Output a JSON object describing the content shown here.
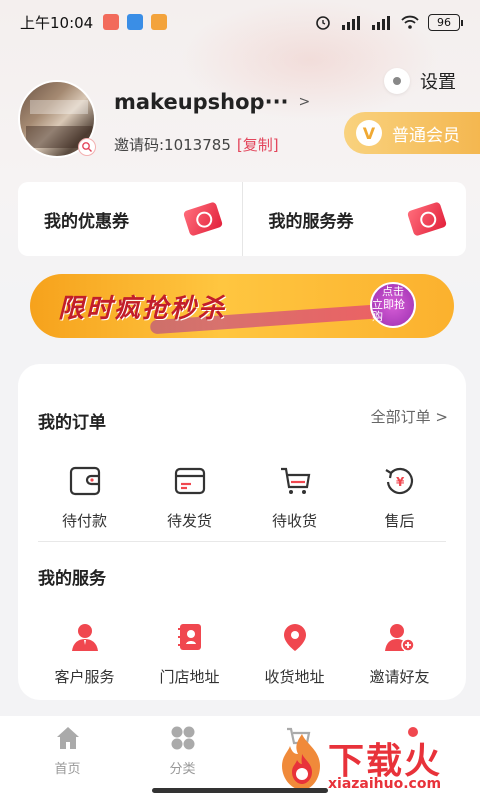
{
  "status_bar": {
    "time": "上午10:04",
    "notif_colors": [
      "#f26b5b",
      "#3a8ee6",
      "#f3a33b"
    ],
    "battery": "96"
  },
  "profile": {
    "settings_label": "设置",
    "username": "makeupshop···",
    "invite_label": "邀请码:1013785",
    "copy_label": "[复制]",
    "member_label": "普通会员",
    "member_icon": "V"
  },
  "coupons": [
    {
      "label": "我的优惠券",
      "icon": "coupon-icon"
    },
    {
      "label": "我的服务券",
      "icon": "service-ticket-icon"
    }
  ],
  "banner": {
    "text": "限时疯抢秒杀",
    "button_line1": "点击",
    "button_line2": "立即抢购"
  },
  "orders": {
    "title": "我的订单",
    "all_label": "全部订单",
    "items": [
      {
        "label": "待付款",
        "icon": "wallet-icon"
      },
      {
        "label": "待发货",
        "icon": "card-icon"
      },
      {
        "label": "待收货",
        "icon": "cart-icon"
      },
      {
        "label": "售后",
        "icon": "refund-icon"
      }
    ]
  },
  "services": {
    "title": "我的服务",
    "items": [
      {
        "label": "客户服务",
        "icon": "customer-service-icon"
      },
      {
        "label": "门店地址",
        "icon": "store-address-icon"
      },
      {
        "label": "收货地址",
        "icon": "location-icon"
      },
      {
        "label": "邀请好友",
        "icon": "invite-friend-icon"
      }
    ]
  },
  "tabbar": {
    "items": [
      {
        "label": "首页",
        "icon": "home-icon"
      },
      {
        "label": "分类",
        "icon": "category-icon"
      },
      {
        "label": "",
        "icon": "cart-icon"
      },
      {
        "label": "",
        "icon": "profile-icon"
      }
    ]
  },
  "watermark": {
    "title": "下载火",
    "url": "xiazaihuo.com"
  },
  "colors": {
    "accent": "#e3465c",
    "member_gold": "#f4b750",
    "icon_red": "#f0474f"
  }
}
